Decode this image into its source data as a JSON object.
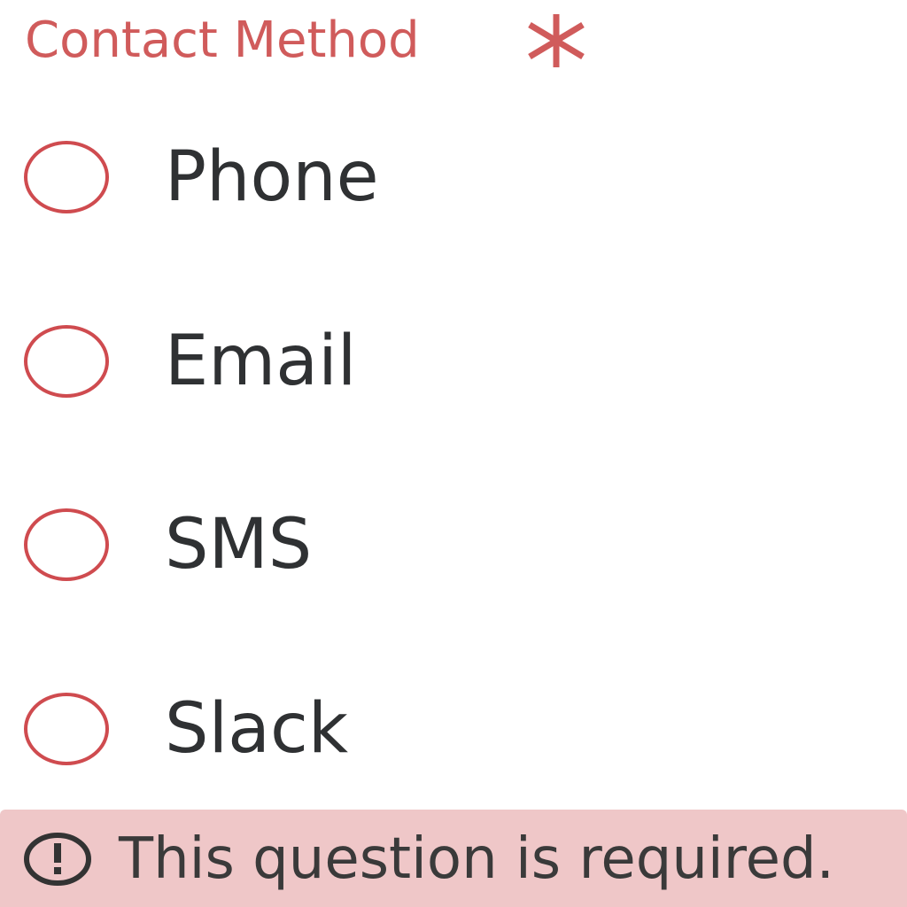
{
  "question": {
    "label": "Contact Method",
    "required_marker": "required-asterisk-icon"
  },
  "options": [
    {
      "label": "Phone",
      "selected": false
    },
    {
      "label": "Email",
      "selected": false
    },
    {
      "label": "SMS",
      "selected": false
    },
    {
      "label": "Slack",
      "selected": false
    }
  ],
  "error": {
    "icon": "exclamation-circle-icon",
    "message": "This question is required."
  },
  "colors": {
    "error_accent": "#d05b5b",
    "radio_border": "#cf4b4f",
    "error_background": "#efc7c8",
    "option_text": "#2f3133"
  }
}
